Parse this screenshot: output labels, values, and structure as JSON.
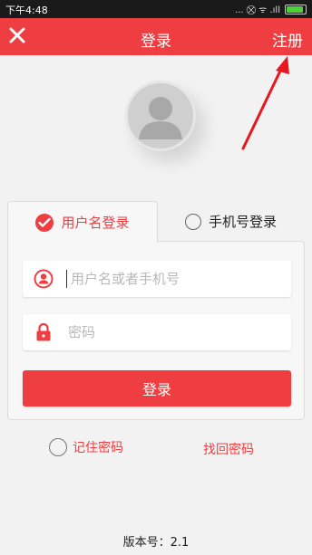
{
  "status_bar": {
    "time": "下午4:48",
    "icons": "... ⛒ ᯤ .ıll"
  },
  "app_bar": {
    "title": "登录",
    "register_label": "注册"
  },
  "tabs": [
    {
      "label": "用户名登录",
      "selected": true
    },
    {
      "label": "手机号登录",
      "selected": false
    }
  ],
  "form": {
    "username_placeholder": "用户名或者手机号",
    "password_placeholder": "密码",
    "login_label": "登录"
  },
  "options": {
    "remember_label": "记住密码",
    "forgot_label": "找回密码"
  },
  "footer": {
    "version_text": "版本号：2.1"
  },
  "colors": {
    "accent": "#ef3e42",
    "background": "#f2f2f2",
    "status_bar": "#1a1a1a"
  },
  "icons": {
    "close": "close-icon",
    "user": "user-circle-icon",
    "lock": "lock-icon",
    "check": "check-circle-icon",
    "avatar": "avatar-placeholder-icon",
    "arrow": "arrow-annotation-icon"
  }
}
